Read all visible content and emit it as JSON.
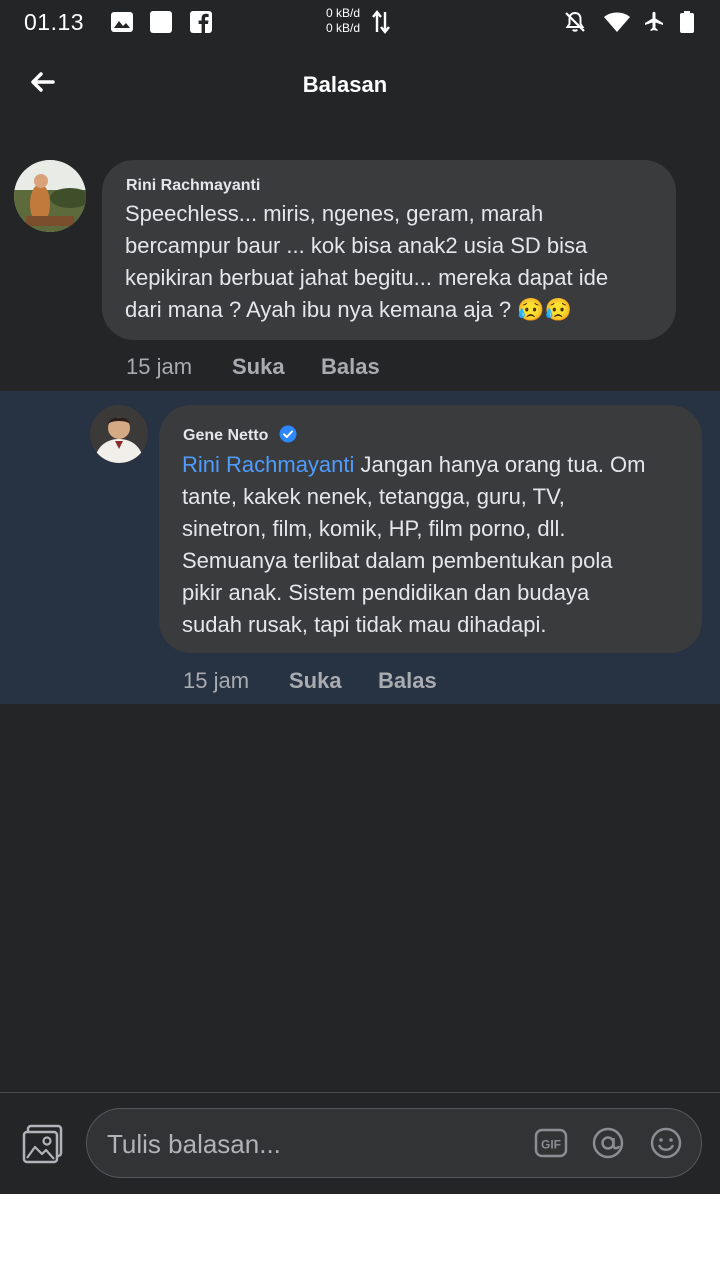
{
  "status_bar": {
    "time": "01.13",
    "net_up": "0 kB/d",
    "net_down": "0 kB/d",
    "icons": [
      "gallery-icon",
      "square-app-icon",
      "facebook-icon",
      "data-arrows-icon",
      "bell-off-icon",
      "wifi-icon",
      "airplane-icon",
      "battery-icon"
    ]
  },
  "header": {
    "title": "Balasan",
    "back_icon": "arrow-left-icon"
  },
  "comment": {
    "author": "Rini Rachmayanti",
    "lines": [
      "Speechless... miris, ngenes, geram, marah",
      "bercampur baur ... kok bisa anak2 usia SD bisa",
      "kepikiran berbuat jahat begitu... mereka dapat ide",
      "dari mana ? Ayah ibu nya kemana aja ? 😥😥"
    ],
    "time": "15 jam",
    "like_label": "Suka",
    "reply_label": "Balas"
  },
  "reply": {
    "author": "Gene Netto",
    "verified_icon": "verified-badge-icon",
    "mention": "Rini Rachmayanti",
    "first_line_rest": " Jangan hanya orang tua. Om",
    "lines": [
      "tante, kakek nenek, tetangga, guru, TV,",
      "sinetron, film, komik, HP, film porno, dll.",
      "Semuanya terlibat dalam pembentukan pola",
      "pikir anak. Sistem pendidikan dan budaya",
      "sudah rusak, tapi tidak mau dihadapi."
    ],
    "time": "15 jam",
    "like_label": "Suka",
    "reply_label": "Balas"
  },
  "composer": {
    "placeholder": "Tulis balasan...",
    "photo_icon": "photo-icon",
    "gif_icon": "gif-icon",
    "mention_icon": "at-sign-icon",
    "emoji_icon": "emoji-icon"
  },
  "colors": {
    "background": "#242527",
    "bubble": "#3a3b3c",
    "reply_highlight": "#273242",
    "mention": "#4f9cff",
    "verified": "#2d88ff",
    "meta_text": "#a8abaf"
  }
}
